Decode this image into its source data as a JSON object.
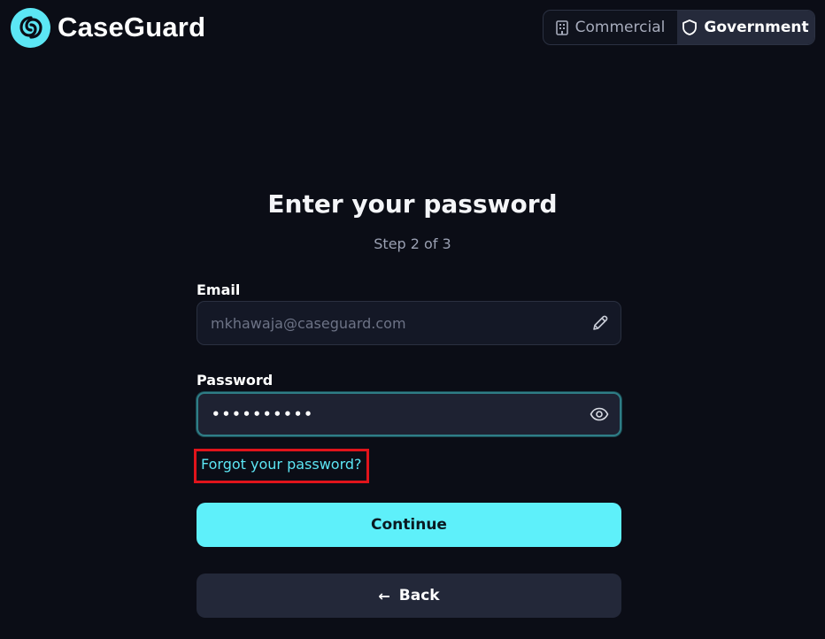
{
  "brand": {
    "name": "CaseGuard"
  },
  "nav": {
    "segments": [
      {
        "label": "Commercial",
        "icon": "building-icon",
        "active": false
      },
      {
        "label": "Government",
        "icon": "shield-icon",
        "active": true
      }
    ]
  },
  "form": {
    "title": "Enter your password",
    "step": "Step 2 of 3",
    "email": {
      "label": "Email",
      "value": "mkhawaja@caseguard.com",
      "icon": "pencil-icon"
    },
    "password": {
      "label": "Password",
      "value": "••••••••••",
      "icon": "eye-icon"
    },
    "forgot_link": "Forgot your password?",
    "continue_label": "Continue",
    "back_label": "Back",
    "back_icon": "←"
  },
  "colors": {
    "background": "#0b0d16",
    "accent": "#5ef0fa",
    "highlight": "#e0141b"
  }
}
